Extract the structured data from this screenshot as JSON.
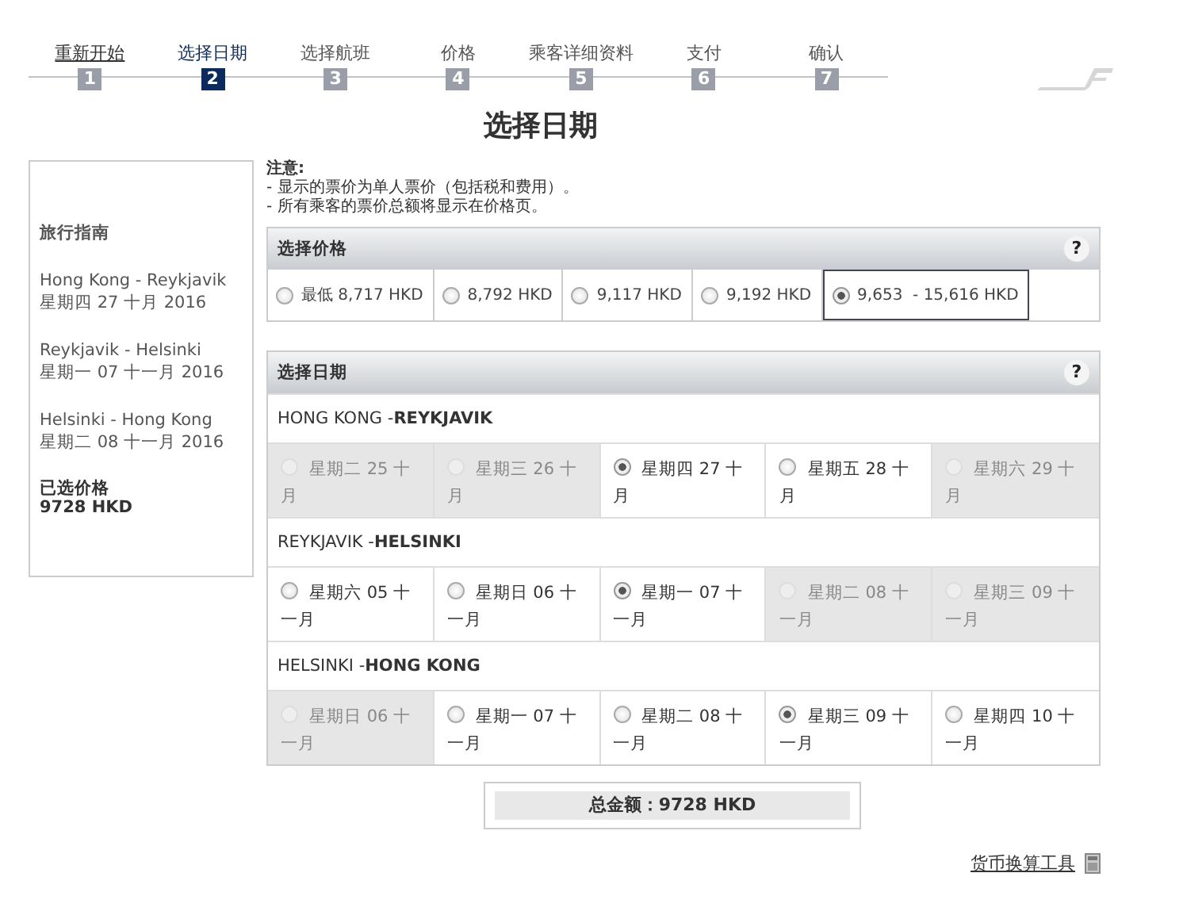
{
  "steps": [
    {
      "label": "重新开始",
      "number": "1",
      "selected": false,
      "link": true
    },
    {
      "label": "选择日期",
      "number": "2",
      "selected": true,
      "link": false
    },
    {
      "label": "选择航班",
      "number": "3",
      "selected": false,
      "link": false
    },
    {
      "label": "价格",
      "number": "4",
      "selected": false,
      "link": false
    },
    {
      "label": "乘客详细资料",
      "number": "5",
      "selected": false,
      "link": false
    },
    {
      "label": "支付",
      "number": "6",
      "selected": false,
      "link": false
    },
    {
      "label": "确认",
      "number": "7",
      "selected": false,
      "link": false
    }
  ],
  "page_title": "选择日期",
  "sidebar": {
    "heading": "旅行指南",
    "legs": [
      {
        "route": "Hong Kong - Reykjavik",
        "date": "星期四 27 十月 2016"
      },
      {
        "route": "Reykjavik - Helsinki",
        "date": "星期一 07 十一月 2016"
      },
      {
        "route": "Helsinki - Hong Kong",
        "date": "星期二 08 十一月 2016"
      }
    ],
    "price_label": "已选价格",
    "price": "9728 HKD"
  },
  "notes": {
    "title": "注意:",
    "lines": [
      "- 显示的票价为单人票价（包括税和费用）。",
      "- 所有乘客的票价总额将显示在价格页。"
    ]
  },
  "price_panel": {
    "title": "选择价格",
    "help": "?",
    "options": [
      {
        "label": "最低 8,717 HKD",
        "selected": false
      },
      {
        "label": "8,792 HKD",
        "selected": false
      },
      {
        "label": "9,117 HKD",
        "selected": false
      },
      {
        "label": "9,192 HKD",
        "selected": false
      },
      {
        "label": "9,653  - 15,616 HKD",
        "selected": true
      }
    ]
  },
  "date_panel": {
    "title": "选择日期",
    "help": "?",
    "routes": [
      {
        "heading": "HONG KONG -**REYKJAVIK**",
        "dates": [
          {
            "label": "星期二 25 十月",
            "selected": false,
            "disabled": true
          },
          {
            "label": "星期三 26 十月",
            "selected": false,
            "disabled": true
          },
          {
            "label": "星期四 27 十月",
            "selected": true,
            "disabled": false
          },
          {
            "label": "星期五 28 十月",
            "selected": false,
            "disabled": false
          },
          {
            "label": "星期六 29 十月",
            "selected": false,
            "disabled": true
          }
        ]
      },
      {
        "heading": "REYKJAVIK -**HELSINKI**",
        "dates": [
          {
            "label": "星期六 05 十一月",
            "selected": false,
            "disabled": false
          },
          {
            "label": "星期日 06 十一月",
            "selected": false,
            "disabled": false
          },
          {
            "label": "星期一 07 十一月",
            "selected": true,
            "disabled": false
          },
          {
            "label": "星期二 08 十一月",
            "selected": false,
            "disabled": true
          },
          {
            "label": "星期三 09 十一月",
            "selected": false,
            "disabled": true
          }
        ]
      },
      {
        "heading": "HELSINKI -**HONG KONG**",
        "dates": [
          {
            "label": "星期日 06 十一月",
            "selected": false,
            "disabled": true
          },
          {
            "label": "星期一 07 十一月",
            "selected": false,
            "disabled": false
          },
          {
            "label": "星期二 08 十一月",
            "selected": false,
            "disabled": false
          },
          {
            "label": "星期三 09 十一月",
            "selected": true,
            "disabled": false
          },
          {
            "label": "星期四 10 十一月",
            "selected": false,
            "disabled": false
          }
        ]
      }
    ]
  },
  "total": "总金额：9728 HKD",
  "converter_link": "货币换算工具"
}
